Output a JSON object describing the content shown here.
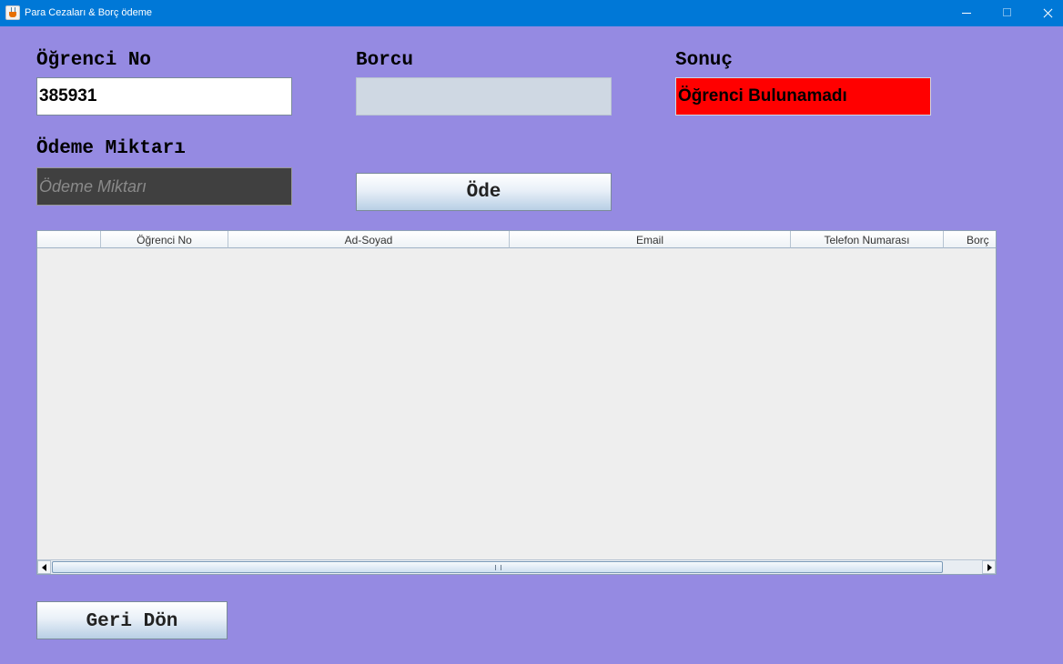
{
  "window": {
    "title": "Para Cezaları & Borç ödeme"
  },
  "form": {
    "student_no_label": "Öğrenci No",
    "student_no_value": "385931",
    "debt_label": "Borcu",
    "debt_value": "",
    "result_label": "Sonuç",
    "result_value": "Öğrenci Bulunamadı",
    "result_color": "#ff0000",
    "payment_label": "Ödeme Miktarı",
    "payment_placeholder": "Ödeme Miktarı",
    "pay_button": "Öde",
    "back_button": "Geri Dön"
  },
  "table": {
    "columns": [
      "",
      "Öğrenci No",
      "Ad-Soyad",
      "Email",
      "Telefon Numarası",
      "Borç"
    ],
    "rows": []
  },
  "colors": {
    "background": "#958ae2",
    "titlebar": "#0078d7"
  }
}
